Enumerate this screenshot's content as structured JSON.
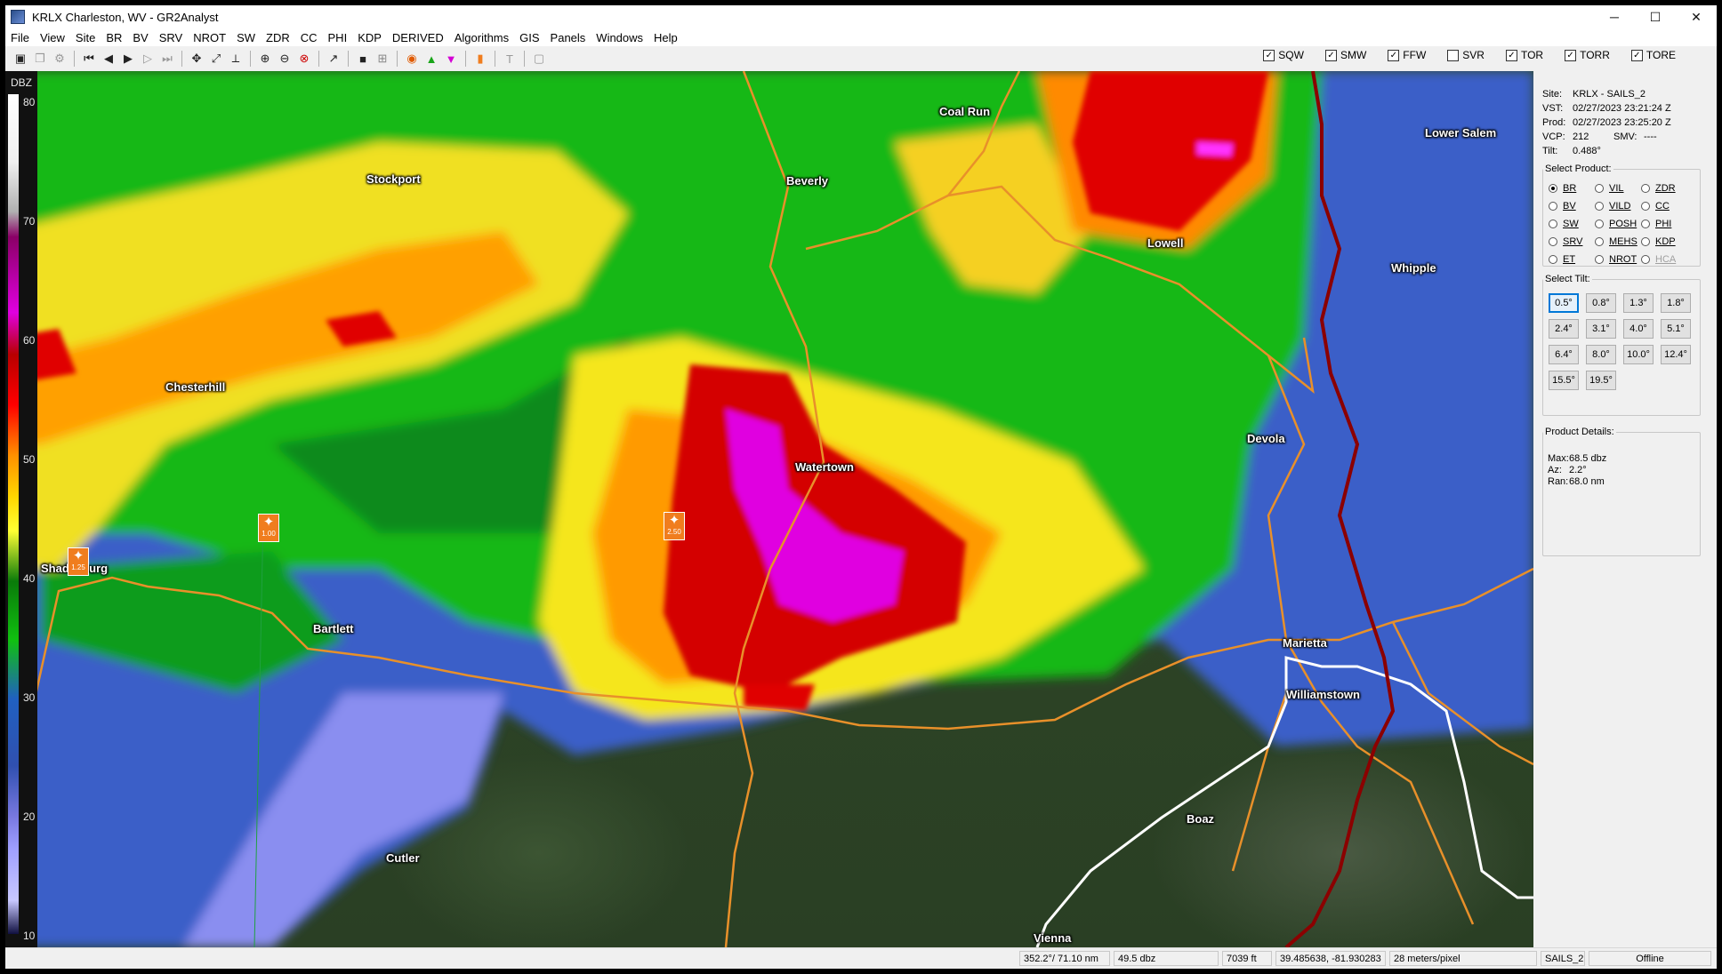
{
  "window": {
    "title": "KRLX Charleston, WV - GR2Analyst",
    "controls": [
      "─",
      "☐",
      "✕"
    ]
  },
  "menu": [
    "File",
    "View",
    "Site",
    "BR",
    "BV",
    "SRV",
    "NROT",
    "SW",
    "ZDR",
    "CC",
    "PHI",
    "KDP",
    "DERIVED",
    "Algorithms",
    "GIS",
    "Panels",
    "Windows",
    "Help"
  ],
  "warning_toggles": [
    {
      "label": "SQW",
      "checked": true
    },
    {
      "label": "SMW",
      "checked": true
    },
    {
      "label": "FFW",
      "checked": true
    },
    {
      "label": "SVR",
      "checked": false
    },
    {
      "label": "TOR",
      "checked": true
    },
    {
      "label": "TORR",
      "checked": true
    },
    {
      "label": "TORE",
      "checked": true
    }
  ],
  "colorbar": {
    "units": "DBZ",
    "labels": [
      "80",
      "70",
      "60",
      "50",
      "40",
      "30",
      "20",
      "10"
    ]
  },
  "places": [
    "Coal Run",
    "Lower Salem",
    "Stockport",
    "Beverly",
    "Lowell",
    "Whipple",
    "Chesterhill",
    "Devola",
    "Watertown",
    "Shadesburg",
    "Bartlett",
    "Marietta",
    "Williamstown",
    "Boaz",
    "Cutler",
    "Vienna"
  ],
  "markers": [
    "1.00",
    "2.50",
    "1.25"
  ],
  "info": {
    "site_label": "Site:",
    "site": "KRLX - SAILS_2",
    "vst_label": "VST:",
    "vst": "02/27/2023  23:21:24 Z",
    "prod_label": "Prod:",
    "prod": "02/27/2023  23:25:20 Z",
    "vcp_label": "VCP:",
    "vcp": "212",
    "smv_label": "SMV:",
    "smv": "----",
    "tilt_label": "Tilt:",
    "tilt": "0.488°"
  },
  "select_product": {
    "legend": "Select Product:",
    "items": [
      {
        "label": "BR",
        "selected": true,
        "disabled": false
      },
      {
        "label": "VIL",
        "selected": false,
        "disabled": false
      },
      {
        "label": "ZDR",
        "selected": false,
        "disabled": false
      },
      {
        "label": "BV",
        "selected": false,
        "disabled": false
      },
      {
        "label": "VILD",
        "selected": false,
        "disabled": false
      },
      {
        "label": "CC",
        "selected": false,
        "disabled": false
      },
      {
        "label": "SW",
        "selected": false,
        "disabled": false
      },
      {
        "label": "POSH",
        "selected": false,
        "disabled": false
      },
      {
        "label": "PHI",
        "selected": false,
        "disabled": false
      },
      {
        "label": "SRV",
        "selected": false,
        "disabled": false
      },
      {
        "label": "MEHS",
        "selected": false,
        "disabled": false
      },
      {
        "label": "KDP",
        "selected": false,
        "disabled": false
      },
      {
        "label": "ET",
        "selected": false,
        "disabled": false
      },
      {
        "label": "NROT",
        "selected": false,
        "disabled": false
      },
      {
        "label": "HCA",
        "selected": false,
        "disabled": true
      }
    ]
  },
  "select_tilt": {
    "legend": "Select Tilt:",
    "items": [
      "0.5°",
      "0.8°",
      "1.3°",
      "1.8°",
      "2.4°",
      "3.1°",
      "4.0°",
      "5.1°",
      "6.4°",
      "8.0°",
      "10.0°",
      "12.4°",
      "15.5°",
      "19.5°"
    ],
    "active": "0.5°"
  },
  "product_details": {
    "legend": "Product Details:",
    "max_label": "Max:",
    "max": "68.5 dbz",
    "az_label": "Az:",
    "az": "2.2°",
    "ran_label": "Ran:",
    "ran": "68.0 nm"
  },
  "status": {
    "azran": "352.2°/ 71.10 nm",
    "value": "49.5 dbz",
    "height": "7039 ft",
    "latlon": "39.485638, -81.930283",
    "scale": "28 meters/pixel",
    "site": "SAILS_2",
    "state": "Offline"
  },
  "colors": {
    "accent": "#0078d7",
    "road": "#e8902a",
    "interstate": "#8b0000",
    "river": "#ffffff",
    "marker": "#f07d1e"
  }
}
